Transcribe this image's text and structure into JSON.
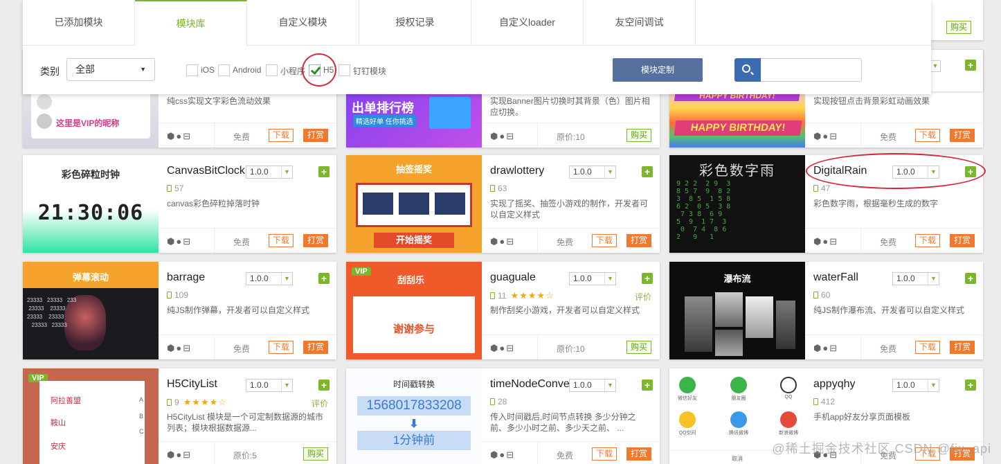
{
  "tabs": [
    "已添加模块",
    "模块库",
    "自定义模块",
    "授权记录",
    "自定义loader",
    "友空间调试"
  ],
  "filter": {
    "category_label": "类别",
    "category_value": "全部",
    "platforms": [
      {
        "label": "iOS",
        "checked": false
      },
      {
        "label": "Android",
        "checked": false
      },
      {
        "label": "小程序",
        "checked": false
      },
      {
        "label": "H5",
        "checked": true
      },
      {
        "label": "钉钉模块",
        "checked": false
      }
    ],
    "custom_button": "模块定制",
    "search_placeholder": ""
  },
  "top_right": {
    "buy_label": "购买"
  },
  "row0": [
    {
      "desc": "纯css实现文字彩色流动效果",
      "price": "免费",
      "dl": "下载",
      "tip": "打赏",
      "thumb_text": "这里是VIP的昵称"
    },
    {
      "desc": "实现Banner图片切换时其背景（色）图片相应切换。",
      "price": "原价:10",
      "buy": "购买",
      "thumb_text": "出单排行榜",
      "thumb_sub": "精选好单 任你挑选"
    },
    {
      "desc": "实现按钮点击背景彩虹动画效果",
      "price": "免费",
      "dl": "下载",
      "tip": "打赏",
      "thumb_text": "HAPPY BIRTHDAY!",
      "thumb_text2": "HAPPY BIRTHDAY!"
    }
  ],
  "cards": [
    {
      "name": "CanvasBitClock",
      "version": "1.0.0",
      "count": "57",
      "desc": "canvas彩色碎粒掉落时钟",
      "price": "免费",
      "dl": "下载",
      "tip": "打赏",
      "thumb_title": "彩色碎粒时钟",
      "thumb_time": "21:30:06"
    },
    {
      "name": "drawlottery",
      "version": "1.0.0",
      "count": "63",
      "desc": "实现了摇奖、抽签小游戏的制作，开发者可以自定义样式",
      "price": "免费",
      "dl": "下载",
      "tip": "打赏",
      "thumb_title": "抽签摇奖",
      "thumb_btn": "开始摇奖"
    },
    {
      "name": "DigitalRain",
      "version": "1.0.0",
      "count": "47",
      "desc": "彩色数字雨，根据毫秒生成的数字",
      "price": "免费",
      "dl": "下载",
      "tip": "打赏",
      "thumb_title": "彩色数字雨"
    },
    {
      "name": "barrage",
      "version": "1.0.0",
      "count": "109",
      "desc": "纯JS制作弹幕，开发者可以自定义样式",
      "price": "免费",
      "dl": "下载",
      "tip": "打赏",
      "thumb_title": "弹幕滚动"
    },
    {
      "name": "guaguale",
      "version": "1.0.0",
      "count": "11",
      "stars": "★★★★☆",
      "rate": "评价",
      "desc": "制作刮奖小游戏，开发者可以自定义样式",
      "price": "原价:10",
      "buy": "购买",
      "thumb_title": "刮刮乐",
      "thumb_vip": "VIP",
      "thumb_msg": "谢谢参与"
    },
    {
      "name": "waterFall",
      "version": "1.0.0",
      "count": "60",
      "desc": "纯JS制作瀑布流、开发者可以自定义样式",
      "price": "免费",
      "dl": "下载",
      "tip": "打赏",
      "thumb_title": "瀑布流"
    },
    {
      "name": "H5CityList",
      "version": "1.0.0",
      "count": "9",
      "stars": "★★★★☆",
      "rate": "评价",
      "desc": "H5CityList 模块是一个可定制数据源的城市列表；模块根据数据源...",
      "price": "原价:5",
      "buy": "购买",
      "thumb_vip": "VIP",
      "thumb_cities": [
        "阿拉善盟",
        "鞍山",
        "安庆"
      ],
      "thumb_letters": [
        "A",
        "B",
        "C"
      ]
    },
    {
      "name": "timeNodeConversion",
      "version": "1.0.0",
      "count": "28",
      "desc": "传入时间戳后,时间节点转换 多少分钟之前、多少小时之前、多少天之前、 ...",
      "price": "免费",
      "dl": "下载",
      "tip": "打赏",
      "thumb_title": "时间戳转换",
      "thumb_ts": "1568017833208",
      "thumb_res": "1分钟前"
    },
    {
      "name": "appyqhy",
      "version": "1.0.0",
      "count": "412",
      "desc": "手机app好友分享页面模板",
      "price": "免费",
      "dl": "下载",
      "tip": "打赏",
      "thumb_labels": [
        "微信好友",
        "朋友圈",
        "QQ",
        "QQ空间",
        "腾讯微博",
        "新浪微博"
      ],
      "thumb_cancel": "取消"
    }
  ],
  "watermark": "@稀土掘金技术社区  CSDN @fix_api",
  "colors": {
    "accent": "#7cb72b",
    "orange": "#f07930",
    "blue": "#56709e",
    "highlight": "#d6283a"
  }
}
